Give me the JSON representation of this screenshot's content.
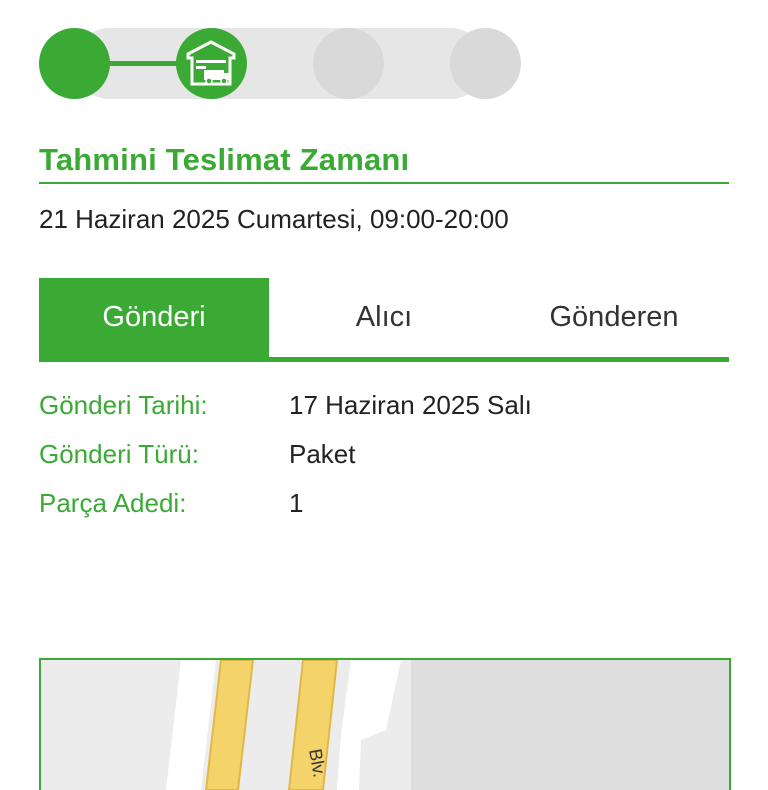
{
  "tracker": {
    "steps": [
      {
        "name": "step-1",
        "state": "done"
      },
      {
        "name": "step-2",
        "state": "current",
        "icon": "warehouse-truck-icon"
      },
      {
        "name": "step-3",
        "state": "pending"
      },
      {
        "name": "step-4",
        "state": "pending"
      }
    ],
    "accent": "#3aaa35",
    "inactive": "#d9d9d9"
  },
  "estimate": {
    "title": "Tahmini Teslimat Zamanı",
    "value": "21 Haziran 2025 Cumartesi, 09:00-20:00"
  },
  "tabs": [
    {
      "label": "Gönderi",
      "active": true
    },
    {
      "label": "Alıcı",
      "active": false
    },
    {
      "label": "Gönderen",
      "active": false
    }
  ],
  "shipment": [
    {
      "label": "Gönderi Tarihi:",
      "value": "17 Haziran 2025 Salı"
    },
    {
      "label": "Gönderi Türü:",
      "value": "Paket"
    },
    {
      "label": "Parça Adedi:",
      "value": "1"
    }
  ],
  "map": {
    "street_label": "Blv."
  }
}
